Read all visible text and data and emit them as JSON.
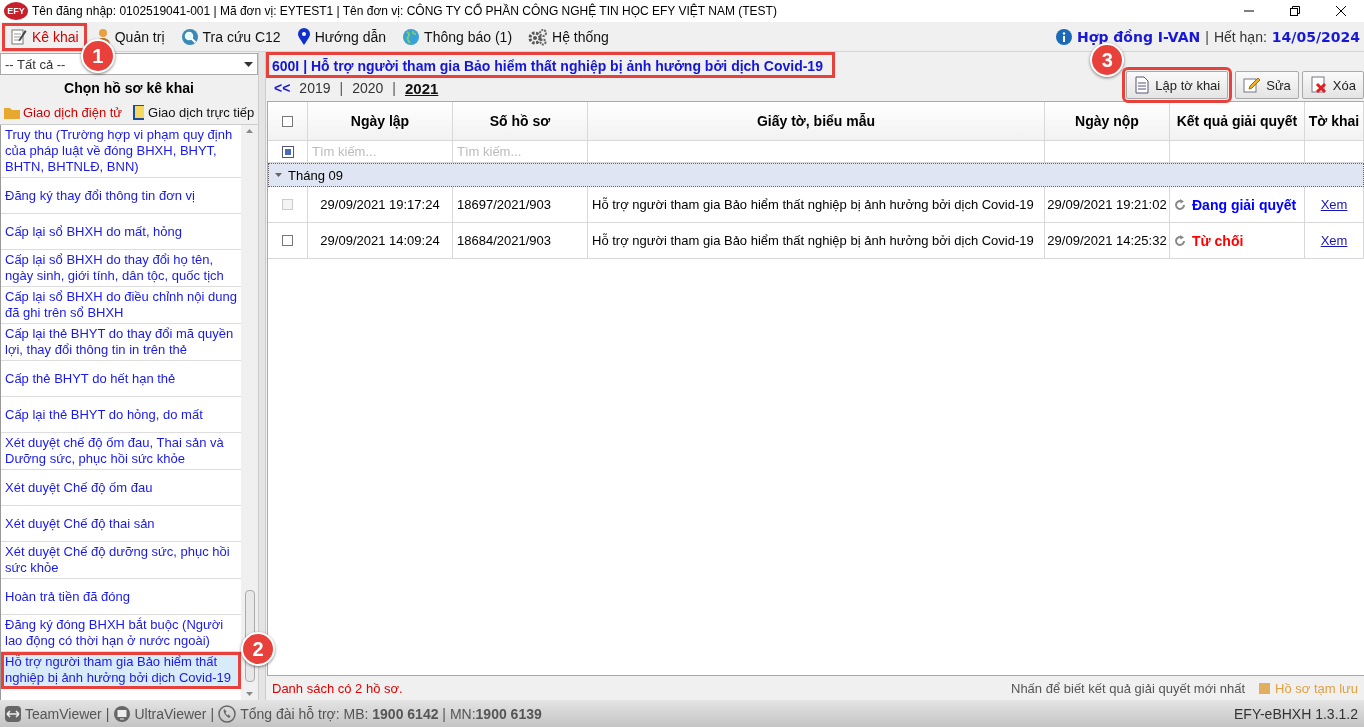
{
  "window": {
    "logo": "EFY",
    "title": "Tên đăng nhập: 0102519041-001 | Mã đơn vị: EYTEST1 | Tên đơn vị: CÔNG TY CỔ PHẦN CÔNG NGHỆ TIN HỌC EFY VIỆT NAM (TEST)"
  },
  "menu": {
    "items": [
      {
        "label": "Kê khai",
        "selected": true,
        "highlighted": true,
        "callout": "1"
      },
      {
        "label": "Quản trị",
        "selected": false,
        "highlighted": false
      },
      {
        "label": "Tra cứu C12",
        "selected": false,
        "highlighted": false
      },
      {
        "label": "Hướng dẫn",
        "selected": false,
        "highlighted": false
      },
      {
        "label": "Thông báo (1)",
        "selected": false,
        "highlighted": false
      },
      {
        "label": "Hệ thống",
        "selected": false,
        "highlighted": false
      }
    ],
    "contract_link": "Hợp đồng I-VAN",
    "separator": "|",
    "expiry_label": "Hết hạn:",
    "expiry_date": "14/05/2024"
  },
  "sidebar": {
    "filter": {
      "value": "-- Tất cả --"
    },
    "heading": "Chọn hồ sơ kê khai",
    "tabs": [
      {
        "label": "Giao dịch điện tử",
        "selected": true
      },
      {
        "label": "Giao dịch trực tiếp",
        "selected": false
      }
    ],
    "items": [
      {
        "label": "Truy thu (Trường hợp vi phạm quy định của pháp luật về đóng BHXH, BHYT, BHTN, BHTNLĐ, BNN)",
        "selected": false,
        "highlighted": false
      },
      {
        "label": "Đăng ký thay đổi thông tin đơn vị",
        "selected": false,
        "highlighted": false
      },
      {
        "label": "Cấp lại sổ BHXH do mất, hỏng",
        "selected": false,
        "highlighted": false
      },
      {
        "label": "Cấp lại sổ BHXH do thay đổi họ tên, ngày sinh, giới tính, dân tộc, quốc tịch",
        "selected": false,
        "highlighted": false
      },
      {
        "label": "Cấp lại sổ BHXH do điều chỉnh nội dung đã ghi trên sổ BHXH",
        "selected": false,
        "highlighted": false
      },
      {
        "label": "Cấp lại thẻ BHYT do thay đổi mã quyền lợi, thay đổi thông tin in trên thẻ",
        "selected": false,
        "highlighted": false
      },
      {
        "label": "Cấp thẻ BHYT do hết hạn thẻ",
        "selected": false,
        "highlighted": false
      },
      {
        "label": "Cấp lại thẻ BHYT do hỏng, do mất",
        "selected": false,
        "highlighted": false
      },
      {
        "label": "Xét duyệt chế độ ốm đau, Thai sản và Dưỡng sức, phục hồi sức khỏe",
        "selected": false,
        "highlighted": false
      },
      {
        "label": "Xét duyệt Chế độ ốm đau",
        "selected": false,
        "highlighted": false
      },
      {
        "label": "Xét duyệt Chế độ thai sản",
        "selected": false,
        "highlighted": false
      },
      {
        "label": "Xét duyệt Chế độ dưỡng sức, phục hồi sức khỏe",
        "selected": false,
        "highlighted": false
      },
      {
        "label": "Hoàn trả tiền đã đóng",
        "selected": false,
        "highlighted": false
      },
      {
        "label": "Đăng ký đóng BHXH bắt buộc (Người lao động có thời hạn ở nước ngoài)",
        "selected": false,
        "highlighted": false
      },
      {
        "label": "Hỗ trợ người tham gia Bảo hiểm thất nghiệp bị ảnh hưởng bởi dịch Covid-19",
        "selected": true,
        "highlighted": true,
        "callout": "2"
      }
    ]
  },
  "main": {
    "form_title": {
      "text": "600I | Hỗ trợ người tham gia Bảo hiểm thất nghiệp bị ảnh hưởng bởi dịch Covid-19",
      "highlighted": true
    },
    "year_nav": {
      "back": "<<",
      "separator": "|",
      "years": [
        {
          "label": "2019",
          "selected": false
        },
        {
          "label": "2020",
          "selected": false
        },
        {
          "label": "2021",
          "selected": true
        }
      ]
    },
    "actions": [
      {
        "label": "Lập tờ khai",
        "highlighted": true,
        "callout": "3"
      },
      {
        "label": "Sửa",
        "highlighted": false
      },
      {
        "label": "Xóa",
        "highlighted": false
      }
    ],
    "table": {
      "columns": [
        "Ngày lập",
        "Số hồ sơ",
        "Giấy tờ, biểu mẫu",
        "Ngày nộp",
        "Kết quả giải quyết",
        "Tờ khai"
      ],
      "header_checkbox": {
        "checked": false
      },
      "filters": [
        {
          "placeholder": "Tìm kiếm..."
        },
        {
          "placeholder": "Tìm kiếm..."
        }
      ],
      "groups": [
        {
          "label": "Tháng 09",
          "expanded": true,
          "rows": [
            {
              "checked": false,
              "disabled": true,
              "created": "29/09/2021 19:17:24",
              "number": "18697/2021/903",
              "form": "Hỗ trợ người tham gia Bảo hiểm thất nghiệp bị ảnh hưởng bởi dịch Covid-19",
              "submitted": "29/09/2021 19:21:02",
              "result": {
                "text": "Đang giải quyết",
                "color": "#0000ff"
              },
              "view_link": "Xem"
            },
            {
              "checked": false,
              "disabled": false,
              "created": "29/09/2021 14:09:24",
              "number": "18684/2021/903",
              "form": "Hỗ trợ người tham gia Bảo hiểm thất nghiệp bị ảnh hưởng bởi dịch Covid-19",
              "submitted": "29/09/2021 14:25:32",
              "result": {
                "text": "Từ chối",
                "color": "#ff0000"
              },
              "view_link": "Xem"
            }
          ]
        }
      ]
    },
    "status": {
      "count_text": "Danh sách có 2 hồ sơ.",
      "hint": "Nhấn để biết kết quả giải quyết mới nhất",
      "legend_label": "Hồ sơ tạm lưu"
    }
  },
  "footer": {
    "apps": [
      {
        "label": "TeamViewer"
      },
      {
        "label": "UltraViewer"
      }
    ],
    "separator": "|",
    "hotline": "Tổng đài hỗ trợ: MB: **1900 6142** | MN:**1900 6139**",
    "version": "EFY-eBHXH 1.3.1.2"
  }
}
